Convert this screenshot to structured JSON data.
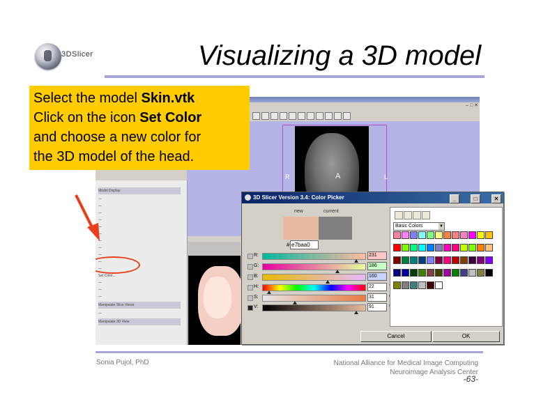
{
  "logo": {
    "text": "3DSlicer"
  },
  "slide": {
    "title": "Visualizing a 3D model",
    "footer_left": "Sonia Pujol, PhD",
    "footer_right_line1": "National Alliance for Medical Image Computing",
    "footer_right_line2": "Neuroimage Analysis Center",
    "page_number": "-63-"
  },
  "callout": {
    "l1_pre": "Select the model ",
    "l1_bold": "Skin.vtk",
    "l2_pre": "Click on the icon ",
    "l2_bold": "Set Color",
    "l3": "and choose a new color for",
    "l4": "the 3D model of the head."
  },
  "slicer": {
    "view_labels": {
      "right": "R",
      "anterior": "A",
      "left": "L"
    },
    "panel": {
      "model_display": "Model Display",
      "set_color": "Set Color...",
      "manipulate_slice_views": "Manipulate Slice Views",
      "manipulate_3d_view": "Manipulate 3D View"
    }
  },
  "color_picker": {
    "title": "3D Slicer Version 3.4: Color Picker",
    "new_label": "new",
    "current_label": "current",
    "new_color": "#e7baa0",
    "current_color": "#808080",
    "hash": "#",
    "hex_value": "e7baa0",
    "palette_name": "Basic Colors",
    "ok": "OK",
    "cancel": "Cancel",
    "sliders": [
      {
        "name": "R:",
        "value": "231",
        "unit": "",
        "fraction": 0.91,
        "selected": false
      },
      {
        "name": "G:",
        "value": "186",
        "unit": "",
        "fraction": 0.73,
        "selected": false
      },
      {
        "name": "B:",
        "value": "160",
        "unit": "",
        "fraction": 0.63,
        "selected": false
      },
      {
        "name": "H:",
        "value": "22",
        "unit": "°",
        "fraction": 0.06,
        "selected": false
      },
      {
        "name": "S:",
        "value": "31",
        "unit": "%",
        "fraction": 0.31,
        "selected": false
      },
      {
        "name": "V:",
        "value": "91",
        "unit": "%",
        "fraction": 0.91,
        "selected": true
      }
    ],
    "value_box_colors": [
      "#ffc8c8",
      "#c8ffc8",
      "#c8d2ff",
      "#ffffff",
      "#ffffff",
      "#ffffff"
    ],
    "swatches": [
      "#ff80a0",
      "#ff80ff",
      "#8080ff",
      "#80ffff",
      "#80ff80",
      "#ffff80",
      "#ff8040",
      "#ff8080",
      "#ff80c0",
      "#ff00ff",
      "#ffff00",
      "#ffc000",
      "#ff0000",
      "#80ff00",
      "#00ff80",
      "#00ffff",
      "#0080ff",
      "#8080c0",
      "#ff00c0",
      "#ff0080",
      "#c0ff00",
      "#80ff00",
      "#ff8000",
      "#ffc080",
      "#800000",
      "#008040",
      "#008080",
      "#004080",
      "#8080ff",
      "#800040",
      "#ff0080",
      "#c00000",
      "#804000",
      "#400040",
      "#800080",
      "#8000ff",
      "#000080",
      "#0000a0",
      "#004000",
      "#408000",
      "#804040",
      "#404000",
      "#a000a0",
      "#008000",
      "#404080",
      "#c0c0c0",
      "#808040",
      "#000000",
      "#808000",
      "#808080",
      "#408080",
      "#c0c0c0",
      "#400000",
      "#ffffff"
    ]
  }
}
